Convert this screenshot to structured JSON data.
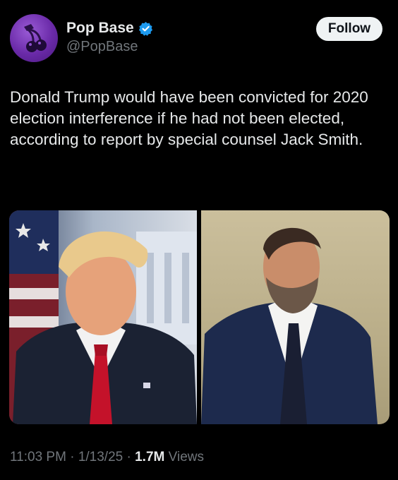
{
  "author": {
    "display_name": "Pop Base",
    "handle": "@PopBase",
    "verified_icon": "verified-badge-icon",
    "avatar_icon": "cherries-icon"
  },
  "follow_button": {
    "label": "Follow"
  },
  "tweet": {
    "text": "Donald Trump would have been convicted for 2020 election interference if he had not been elected, according to report by special counsel Jack Smith."
  },
  "media": {
    "count": 2
  },
  "meta": {
    "time": "11:03 PM",
    "separator": "·",
    "date": "1/13/25",
    "views_count": "1.7M",
    "views_label": "Views"
  },
  "colors": {
    "background": "#000000",
    "text": "#e7e9ea",
    "secondary": "#71767b",
    "verified": "#1d9bf0",
    "follow_bg": "#eff3f4"
  }
}
